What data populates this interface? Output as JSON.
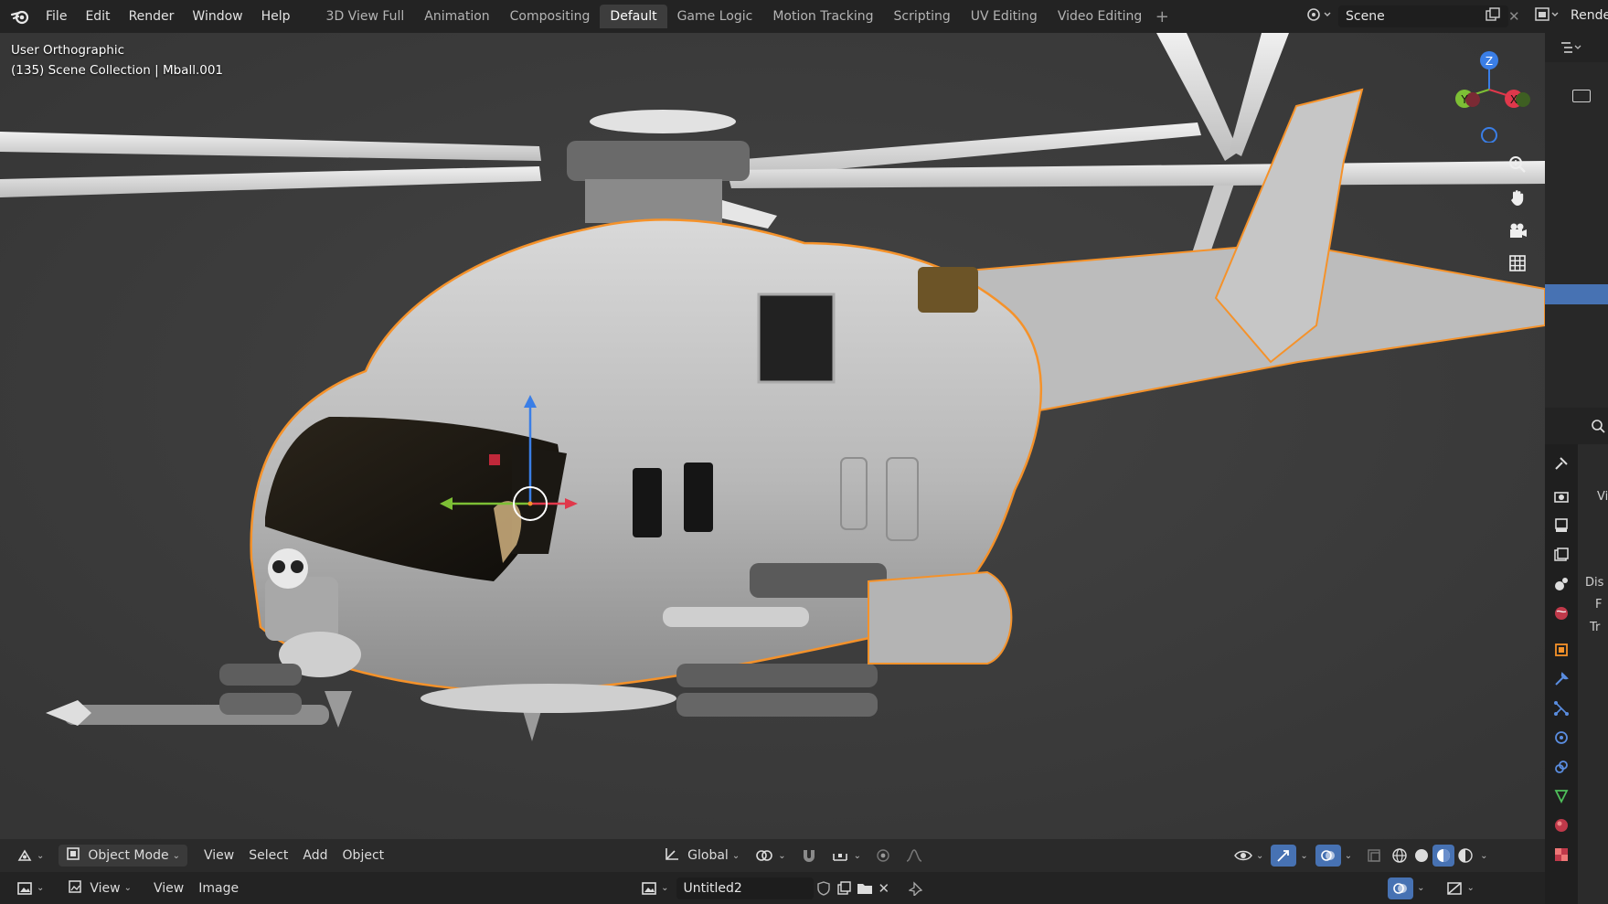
{
  "menu": [
    "File",
    "Edit",
    "Render",
    "Window",
    "Help"
  ],
  "workspace_tabs": [
    {
      "label": "3D View Full",
      "active": false
    },
    {
      "label": "Animation",
      "active": false
    },
    {
      "label": "Compositing",
      "active": false
    },
    {
      "label": "Default",
      "active": true
    },
    {
      "label": "Game Logic",
      "active": false
    },
    {
      "label": "Motion Tracking",
      "active": false
    },
    {
      "label": "Scripting",
      "active": false
    },
    {
      "label": "UV Editing",
      "active": false
    },
    {
      "label": "Video Editing",
      "active": false
    }
  ],
  "scene": {
    "name": "Scene",
    "render_layer_partial": "Rende"
  },
  "viewport": {
    "view_name": "User Orthographic",
    "collection_info": "(135) Scene Collection | Mball.001",
    "gizmo_axes": [
      "Z",
      "Y",
      "X"
    ]
  },
  "viewport_header": {
    "mode": "Object Mode",
    "menus": [
      "View",
      "Select",
      "Add",
      "Object"
    ],
    "transform_orientation": "Global"
  },
  "image_editor": {
    "menus": [
      "View",
      "View",
      "Image"
    ],
    "image_name": "Untitled2"
  },
  "properties_partial": [
    "Vi",
    "Dis",
    "F",
    "Tr"
  ],
  "colors": {
    "accent_blue": "#4772b3",
    "selection_orange": "#f5922a",
    "axis_x": "#e0384b",
    "axis_y": "#7dbf35",
    "axis_z": "#3a7ee6"
  }
}
